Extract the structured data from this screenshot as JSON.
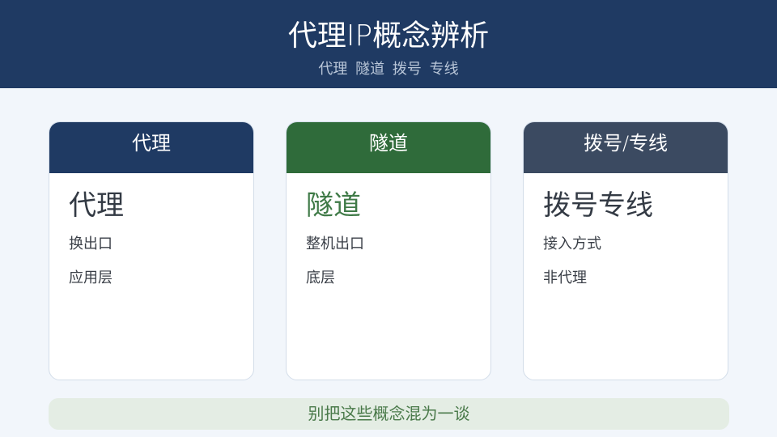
{
  "header": {
    "title": "代理IP概念辨析",
    "subtitle": "代理 隧道 拨号 专线"
  },
  "cards": [
    {
      "header_label": "代理",
      "header_color": "#1f3a63",
      "title": "代理",
      "title_color": "#333a44",
      "lines": [
        "换出口",
        "应用层"
      ]
    },
    {
      "header_label": "隧道",
      "header_color": "#2f6b3a",
      "title": "隧道",
      "title_color": "#3f7a47",
      "lines": [
        "整机出口",
        "底层"
      ]
    },
    {
      "header_label": "拨号/专线",
      "header_color": "#3b4a61",
      "title": "拨号专线",
      "title_color": "#333a44",
      "lines": [
        "接入方式",
        "非代理"
      ]
    }
  ],
  "footer": {
    "text": "别把这些概念混为一谈"
  }
}
